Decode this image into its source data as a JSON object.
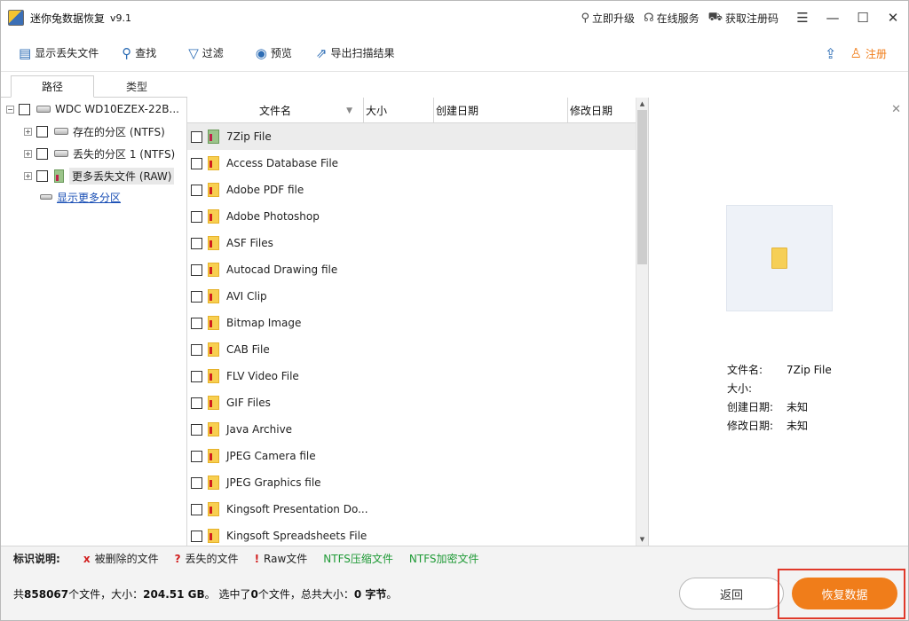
{
  "app": {
    "title": "迷你兔数据恢复",
    "version": "v9.1"
  },
  "title_links": {
    "upgrade": "立即升级",
    "online_service": "在线服务",
    "get_code": "获取注册码"
  },
  "toolbar": {
    "show_lost": "显示丢失文件",
    "find": "查找",
    "filter": "过滤",
    "preview": "预览",
    "export": "导出扫描结果",
    "register": "注册"
  },
  "tabs": {
    "path": "路径",
    "type": "类型"
  },
  "tree": {
    "root": "WDC WD10EZEX-22B...",
    "items": [
      "存在的分区 (NTFS)",
      "丢失的分区 1 (NTFS)",
      "更多丢失文件 (RAW)"
    ],
    "more_partitions": "显示更多分区"
  },
  "columns": {
    "name": "文件名",
    "size": "大小",
    "created": "创建日期",
    "modified": "修改日期"
  },
  "files": [
    "7Zip File",
    "Access Database File",
    "Adobe PDF file",
    "Adobe Photoshop",
    "ASF Files",
    "Autocad Drawing file",
    "AVI Clip",
    "Bitmap Image",
    "CAB File",
    "FLV Video File",
    "GIF Files",
    "Java Archive",
    "JPEG Camera file",
    "JPEG Graphics file",
    "Kingsoft Presentation Do...",
    "Kingsoft Spreadsheets File"
  ],
  "preview": {
    "name_label": "文件名:",
    "name_value": "7Zip File",
    "size_label": "大小:",
    "size_value": "",
    "created_label": "创建日期:",
    "created_value": "未知",
    "modified_label": "修改日期:",
    "modified_value": "未知"
  },
  "legend": {
    "title": "标识说明:",
    "deleted_mark": "x",
    "deleted": "被删除的文件",
    "lost_mark": "?",
    "lost": "丢失的文件",
    "raw_mark": "!",
    "raw": "Raw文件",
    "ntfs_compressed": "NTFS压缩文件",
    "ntfs_encrypted": "NTFS加密文件"
  },
  "status": {
    "prefix": "共",
    "file_count": "858067",
    "files_unit": "个文件，大小：",
    "total_size": "204.51 GB",
    "selected_prefix": "。 选中了",
    "selected_count": "0",
    "selected_unit": "个文件，总共大小：",
    "selected_size": "0 字节",
    "suffix": "。"
  },
  "buttons": {
    "back": "返回",
    "recover": "恢复数据"
  },
  "colors": {
    "accent": "#f07d1a",
    "link": "#1a4fb5",
    "ntfs_green": "#1f9a36",
    "marker_red": "#d11e1e",
    "highlight_frame": "#e0392a"
  }
}
